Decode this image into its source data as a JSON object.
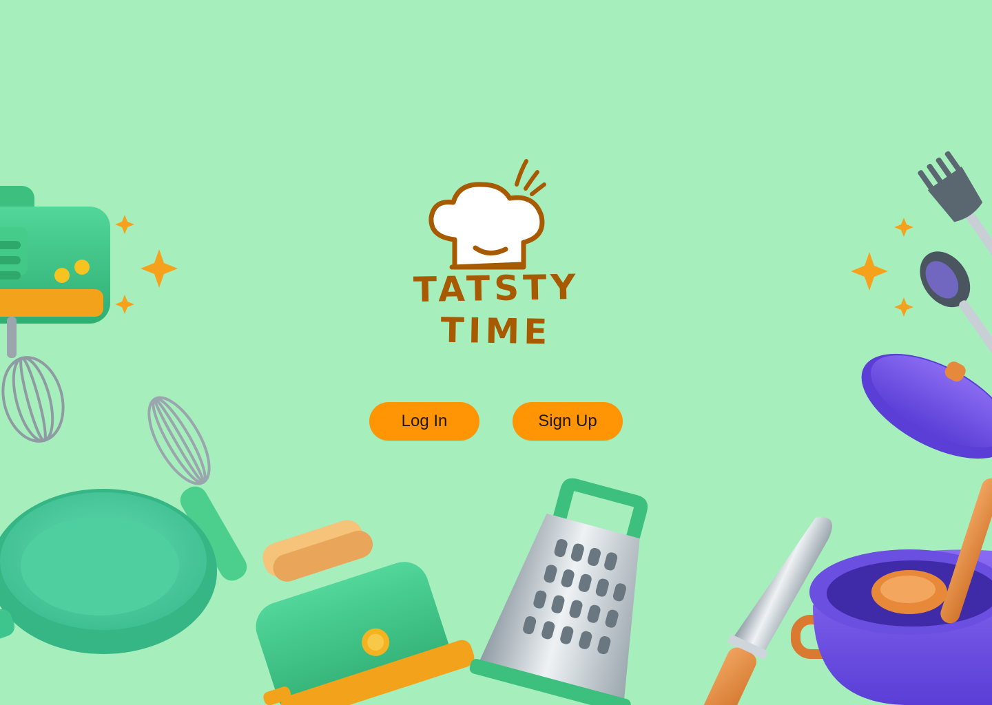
{
  "brand": {
    "logo_line1": "TATSTY",
    "logo_line2": "TIME",
    "brand_color": "#a85a00"
  },
  "auth": {
    "login_label": "Log In",
    "signup_label": "Sign Up",
    "button_color": "#ff9404"
  },
  "theme": {
    "background": "#a6efbd"
  },
  "illustrations": [
    "hand-mixer-icon",
    "whisk-icon",
    "frying-pan-icon",
    "toaster-icon",
    "cheese-grater-icon",
    "chef-knife-icon",
    "fork-icon",
    "spoon-icon",
    "cooking-pot-icon",
    "pot-lid-icon",
    "ladle-icon",
    "sparkle-icon"
  ]
}
